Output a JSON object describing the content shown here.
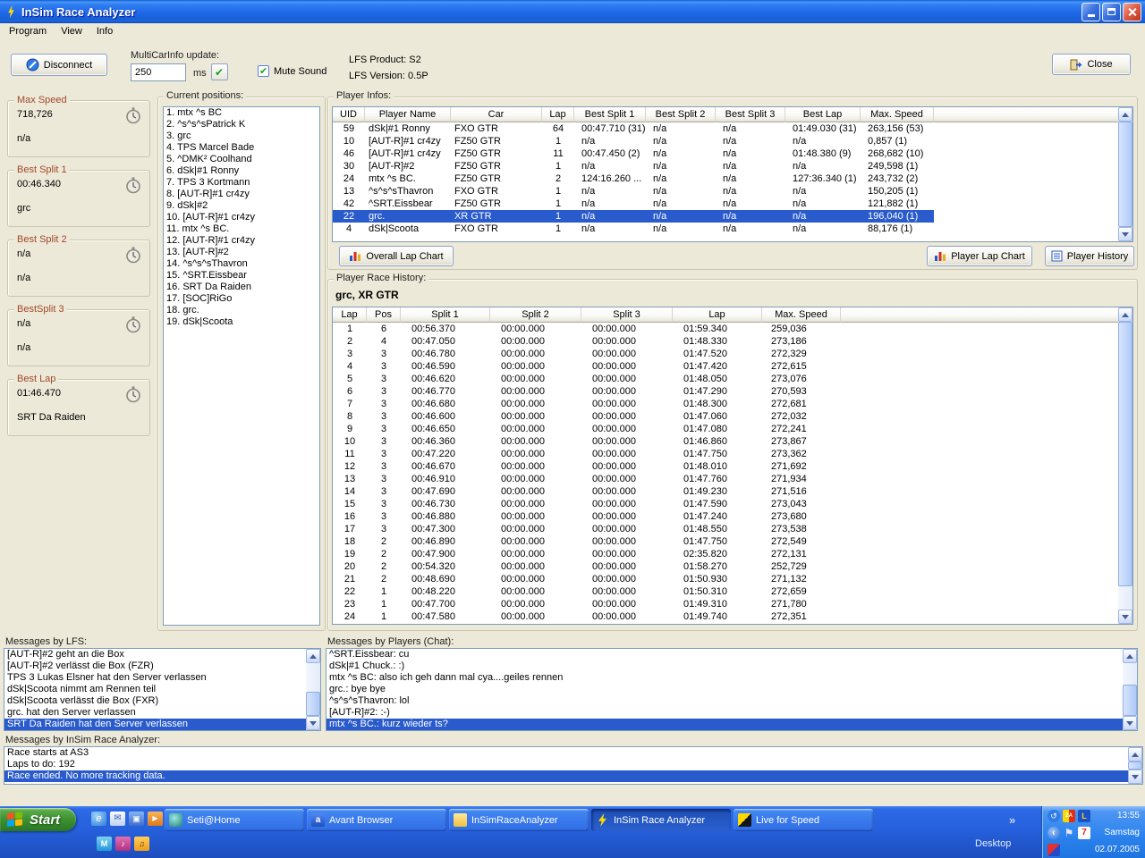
{
  "window": {
    "title": "InSim Race Analyzer"
  },
  "menu": [
    "Program",
    "View",
    "Info"
  ],
  "toolbar": {
    "disconnect": "Disconnect",
    "multicar_label": "MultiCarInfo update:",
    "multicar_value": "250",
    "multicar_unit": "ms",
    "mute_sound": "Mute Sound",
    "lfs_product": "LFS Product: S2",
    "lfs_version": "LFS Version: 0.5P",
    "close": "Close"
  },
  "stats": [
    {
      "title": "Max Speed",
      "value": "718,726",
      "holder": "n/a"
    },
    {
      "title": "Best Split 1",
      "value": "00:46.340",
      "holder": "grc"
    },
    {
      "title": "Best Split 2",
      "value": "n/a",
      "holder": "n/a"
    },
    {
      "title": "BestSplit 3",
      "value": "n/a",
      "holder": "n/a"
    },
    {
      "title": "Best Lap",
      "value": "01:46.470",
      "holder": "SRT Da Raiden"
    }
  ],
  "positions": {
    "title": "Current positions:",
    "items": [
      "1. mtx ^s BC",
      "2. ^s^s^sPatrick K",
      "3. grc",
      "4. TPS Marcel Bade",
      "5. ^DMK² Coolhand",
      "6. dSk|#1 Ronny",
      "7. TPS 3 Kortmann",
      "8. [AUT-R]#1 cr4zy",
      "9. dSk|#2",
      "10. [AUT-R]#1 cr4zy",
      "11. mtx ^s BC.",
      "12. [AUT-R]#1 cr4zy",
      "13. [AUT-R]#2",
      "14. ^s^s^sThavron",
      "15. ^SRT.Eissbear",
      "16. SRT Da Raiden",
      "17. [SOC]RiGo",
      "18. grc.",
      "19. dSk|Scoota"
    ]
  },
  "player_infos": {
    "title": "Player Infos:",
    "columns": [
      "UID",
      "Player Name",
      "Car",
      "Lap",
      "Best Split 1",
      "Best Split 2",
      "Best Split 3",
      "Best Lap",
      "Max. Speed"
    ],
    "rows": [
      [
        "59",
        "dSk|#1 Ronny",
        "FXO GTR",
        "64",
        "00:47.710 (31)",
        "n/a",
        "n/a",
        "01:49.030 (31)",
        "263,156 (53)"
      ],
      [
        "10",
        "[AUT-R]#1 cr4zy",
        "FZ50 GTR",
        "1",
        "n/a",
        "n/a",
        "n/a",
        "n/a",
        "0,857 (1)"
      ],
      [
        "46",
        "[AUT-R]#1 cr4zy",
        "FZ50 GTR",
        "11",
        "00:47.450 (2)",
        "n/a",
        "n/a",
        "01:48.380 (9)",
        "268,682 (10)"
      ],
      [
        "30",
        "[AUT-R]#2",
        "FZ50 GTR",
        "1",
        "n/a",
        "n/a",
        "n/a",
        "n/a",
        "249,598 (1)"
      ],
      [
        "24",
        "mtx ^s BC.",
        "FZ50 GTR",
        "2",
        "124:16.260 ...",
        "n/a",
        "n/a",
        "127:36.340 (1)",
        "243,732 (2)"
      ],
      [
        "13",
        "^s^s^sThavron",
        "FXO GTR",
        "1",
        "n/a",
        "n/a",
        "n/a",
        "n/a",
        "150,205 (1)"
      ],
      [
        "42",
        "^SRT.Eissbear",
        "FZ50 GTR",
        "1",
        "n/a",
        "n/a",
        "n/a",
        "n/a",
        "121,882 (1)"
      ],
      [
        "22",
        "grc.",
        "XR GTR",
        "1",
        "n/a",
        "n/a",
        "n/a",
        "n/a",
        "196,040 (1)"
      ],
      [
        "4",
        "dSk|Scoota",
        "FXO GTR",
        "1",
        "n/a",
        "n/a",
        "n/a",
        "n/a",
        "88,176 (1)"
      ]
    ],
    "selected_index": 7,
    "overall_chart_label": "Overall Lap Chart",
    "player_chart_label": "Player Lap Chart",
    "player_history_label": "Player History"
  },
  "race_history": {
    "title": "Player Race History:",
    "subtitle": "grc, XR GTR",
    "columns": [
      "Lap",
      "Pos",
      "Split 1",
      "Split 2",
      "Split 3",
      "Lap",
      "Max. Speed"
    ],
    "rows": [
      [
        "1",
        "6",
        "00:56.370",
        "00:00.000",
        "00:00.000",
        "01:59.340",
        "259,036"
      ],
      [
        "2",
        "4",
        "00:47.050",
        "00:00.000",
        "00:00.000",
        "01:48.330",
        "273,186"
      ],
      [
        "3",
        "3",
        "00:46.780",
        "00:00.000",
        "00:00.000",
        "01:47.520",
        "272,329"
      ],
      [
        "4",
        "3",
        "00:46.590",
        "00:00.000",
        "00:00.000",
        "01:47.420",
        "272,615"
      ],
      [
        "5",
        "3",
        "00:46.620",
        "00:00.000",
        "00:00.000",
        "01:48.050",
        "273,076"
      ],
      [
        "6",
        "3",
        "00:46.770",
        "00:00.000",
        "00:00.000",
        "01:47.290",
        "270,593"
      ],
      [
        "7",
        "3",
        "00:46.680",
        "00:00.000",
        "00:00.000",
        "01:48.300",
        "272,681"
      ],
      [
        "8",
        "3",
        "00:46.600",
        "00:00.000",
        "00:00.000",
        "01:47.060",
        "272,032"
      ],
      [
        "9",
        "3",
        "00:46.650",
        "00:00.000",
        "00:00.000",
        "01:47.080",
        "272,241"
      ],
      [
        "10",
        "3",
        "00:46.360",
        "00:00.000",
        "00:00.000",
        "01:46.860",
        "273,867"
      ],
      [
        "11",
        "3",
        "00:47.220",
        "00:00.000",
        "00:00.000",
        "01:47.750",
        "273,362"
      ],
      [
        "12",
        "3",
        "00:46.670",
        "00:00.000",
        "00:00.000",
        "01:48.010",
        "271,692"
      ],
      [
        "13",
        "3",
        "00:46.910",
        "00:00.000",
        "00:00.000",
        "01:47.760",
        "271,934"
      ],
      [
        "14",
        "3",
        "00:47.690",
        "00:00.000",
        "00:00.000",
        "01:49.230",
        "271,516"
      ],
      [
        "15",
        "3",
        "00:46.730",
        "00:00.000",
        "00:00.000",
        "01:47.590",
        "273,043"
      ],
      [
        "16",
        "3",
        "00:46.880",
        "00:00.000",
        "00:00.000",
        "01:47.240",
        "273,680"
      ],
      [
        "17",
        "3",
        "00:47.300",
        "00:00.000",
        "00:00.000",
        "01:48.550",
        "273,538"
      ],
      [
        "18",
        "2",
        "00:46.890",
        "00:00.000",
        "00:00.000",
        "01:47.750",
        "272,549"
      ],
      [
        "19",
        "2",
        "00:47.900",
        "00:00.000",
        "00:00.000",
        "02:35.820",
        "272,131"
      ],
      [
        "20",
        "2",
        "00:54.320",
        "00:00.000",
        "00:00.000",
        "01:58.270",
        "252,729"
      ],
      [
        "21",
        "2",
        "00:48.690",
        "00:00.000",
        "00:00.000",
        "01:50.930",
        "271,132"
      ],
      [
        "22",
        "1",
        "00:48.220",
        "00:00.000",
        "00:00.000",
        "01:50.310",
        "272,659"
      ],
      [
        "23",
        "1",
        "00:47.700",
        "00:00.000",
        "00:00.000",
        "01:49.310",
        "271,780"
      ],
      [
        "24",
        "1",
        "00:47.580",
        "00:00.000",
        "00:00.000",
        "01:49.740",
        "272,351"
      ]
    ]
  },
  "messages_lfs": {
    "title": "Messages by LFS:",
    "items": [
      "[AUT-R]#2 geht an die Box",
      "[AUT-R]#2 verlässt die Box (FZR)",
      "TPS 3 Lukas Elsner hat den Server verlassen",
      "dSk|Scoota nimmt am Rennen teil",
      "dSk|Scoota verlässt die Box (FXR)",
      "grc. hat den Server verlassen",
      "SRT Da Raiden hat den Server verlassen"
    ],
    "selected_index": 6
  },
  "messages_chat": {
    "title": "Messages by Players (Chat):",
    "items": [
      "^SRT.Eissbear: cu",
      "dSk|#1 Chuck.: :)",
      "mtx ^s BC: also ich geh dann mal cya....geiles rennen",
      "grc.: bye bye",
      "^s^s^sThavron: lol",
      "[AUT-R]#2: :-)",
      "mtx ^s BC.: kurz wieder ts?"
    ],
    "selected_index": 6
  },
  "messages_insim": {
    "title": "Messages by InSim Race Analyzer:",
    "items": [
      "Race starts at AS3",
      "Laps to do: 192",
      "Race ended. No more tracking data."
    ],
    "selected_index": 2
  },
  "taskbar": {
    "start": "Start",
    "quick_launch_row1": [
      "internet-explorer-icon",
      "outlook-icon",
      "show-desktop-icon",
      "media-player-icon"
    ],
    "quick_launch_row2": [
      "msn-icon",
      "media-icon",
      "winamp-icon"
    ],
    "buttons": [
      {
        "label": "Seti@Home",
        "icon": "seti-icon",
        "active": false
      },
      {
        "label": "Avant Browser",
        "icon": "avant-icon",
        "active": false
      },
      {
        "label": "InSimRaceAnalyzer",
        "icon": "folder-icon",
        "active": false
      },
      {
        "label": "InSim Race Analyzer",
        "icon": "insim-icon",
        "active": true
      },
      {
        "label": "Live for Speed",
        "icon": "lfs-icon",
        "active": false
      }
    ],
    "overflow_chevron": "»",
    "desktop_label": "Desktop",
    "tray": {
      "icons_row1": [
        "restore-arrow-icon",
        "zonealarm-icon",
        "lfs-bolt-icon"
      ],
      "icons_row2": [
        "hide-icons-chevron",
        "flag-icon",
        "seven-icon"
      ],
      "icons_row3": [
        "alert-icon"
      ],
      "time": "13:55",
      "day": "Samstag",
      "date": "02.07.2005"
    }
  }
}
